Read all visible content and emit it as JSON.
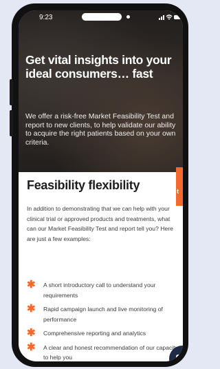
{
  "status": {
    "time": "9:23"
  },
  "hero": {
    "title": "Get vital insights into your ideal consumers… fast",
    "body": "We offer a risk-free Market Feasibility Test and report to new clients, to help validate our ability to acquire the right patients based on your own criteria."
  },
  "section": {
    "title": "Feasibility flexibility",
    "intro": "In addition to demonstrating that we can help with your clinical trial or approved products and treatments, what can our Market Feasibility Test and report tell you? Here are just a few examples:",
    "items": [
      "A short introductory call to understand your requirements",
      "Rapid campaign launch and live monitoring of performance",
      "Comprehensive reporting and analytics",
      "A clear and honest recommendation of our capacity to help you"
    ]
  },
  "colors": {
    "accent": "#f26a2e",
    "chat": "#1f2a44",
    "background": "#e4e8f4"
  },
  "icons": {
    "bullet": "asterisk-icon",
    "chat": "chat-bubble-icon"
  }
}
